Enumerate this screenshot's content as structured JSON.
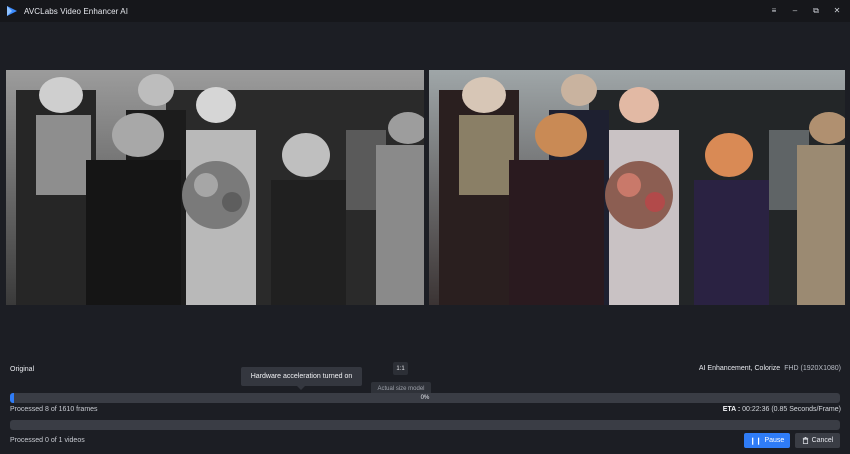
{
  "app": {
    "title": "AVCLabs Video Enhancer AI",
    "logo_icon": "play-triangle-logo"
  },
  "window_controls": [
    {
      "name": "menu",
      "glyph": "≡"
    },
    {
      "name": "minimize",
      "glyph": "–"
    },
    {
      "name": "restore",
      "glyph": "⧉"
    },
    {
      "name": "close",
      "glyph": "✕"
    }
  ],
  "preview": {
    "left_label": "Original",
    "right_label": "AI Enhancement, Colorize",
    "right_resolution": "FHD (1920X1080)",
    "ratio_button": "1:1",
    "ratio_tooltip": "Actual size model",
    "hw_tooltip": "Hardware acceleration turned on"
  },
  "frames": {
    "percent_label": "0%",
    "progress_fraction": 0.005,
    "status": "Processed 8 of 1610 frames",
    "eta_label": "ETA :",
    "eta_value": "00:22:36 (0.85 Seconds/Frame)"
  },
  "videos": {
    "progress_fraction": 0,
    "status": "Processed 0 of 1 videos"
  },
  "buttons": {
    "pause_label": "Pause",
    "pause_icon": "pause-icon",
    "cancel_label": "Cancel",
    "cancel_icon": "trash-icon"
  },
  "colors": {
    "accent": "#2f7cf6",
    "background": "#1c1e24"
  }
}
